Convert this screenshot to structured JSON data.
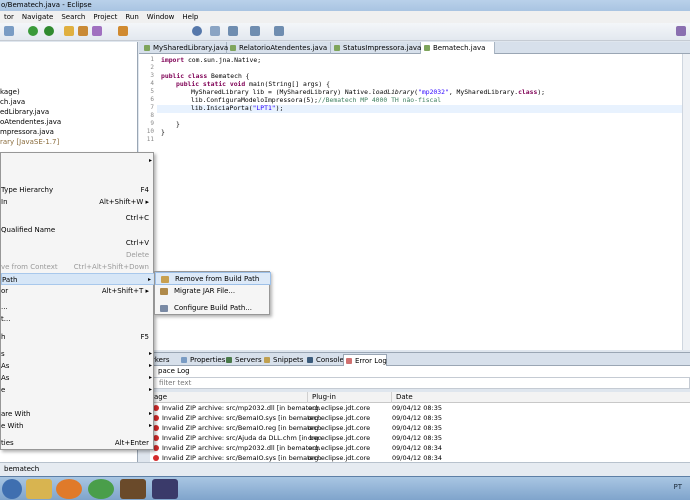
{
  "window": {
    "title": "o/Bematech.java - Eclipse"
  },
  "menu": [
    "tor",
    "Navigate",
    "Search",
    "Project",
    "Run",
    "Window",
    "Help"
  ],
  "tree": [
    "kage)",
    "ch.java",
    "edLibrary.java",
    "oAtendentes.java",
    "mpressora.java",
    "rary [JavaSE-1.7]"
  ],
  "tabs": [
    "MySharedLibrary.java",
    "RelatorioAtendentes.java",
    "StatusImpressora.java",
    "Bematech.java"
  ],
  "line_numbers": [
    "1",
    "2",
    "3",
    "4",
    "5",
    "6",
    "7",
    "8",
    "9",
    "10",
    "11"
  ],
  "code": {
    "l1_kw": "import",
    "l1_rest": " com.sun.jna.Native;",
    "l3_kw": "public class",
    "l3_rest": " Bematech {",
    "l4_kw": "public static void",
    "l4_rest": " main(String[] args) {",
    "l5_a": "MySharedLibrary lib = (MySharedLibrary) Native.",
    "l5_method": "loadLibrary",
    "l5_b": "(",
    "l5_str": "\"mp2032\"",
    "l5_c": ", MySharedLibrary.",
    "l5_kw": "class",
    "l5_d": ");",
    "l6_a": "lib.ConfiguraModeloImpressora(5);",
    "l6_cm": "//Bematech MP 4000 TH não-fiscal",
    "l7_a": "lib.IniciaPorta(",
    "l7_str": "\"LPT1\"",
    "l7_b": ");",
    "l9": "}",
    "l10": "}"
  },
  "context_menu": [
    {
      "label": "",
      "shortcut": "",
      "arrow": true,
      "disabled": false
    },
    {
      "label": "Type Hierarchy",
      "shortcut": "F4",
      "arrow": false,
      "disabled": false
    },
    {
      "label": "In",
      "shortcut": "Alt+Shift+W ▸",
      "arrow": false,
      "disabled": false
    },
    {
      "label": "",
      "shortcut": "Ctrl+C",
      "arrow": false,
      "disabled": false
    },
    {
      "label": "Qualified Name",
      "shortcut": "",
      "arrow": false,
      "disabled": false
    },
    {
      "label": "",
      "shortcut": "Ctrl+V",
      "arrow": false,
      "disabled": false
    },
    {
      "label": "",
      "shortcut": "Delete",
      "arrow": false,
      "disabled": true
    },
    {
      "label": "ve from Context",
      "shortcut": "Ctrl+Alt+Shift+Down",
      "arrow": false,
      "disabled": true
    },
    {
      "label": "Path",
      "shortcut": "",
      "arrow": true,
      "disabled": false
    },
    {
      "label": "or",
      "shortcut": "Alt+Shift+T ▸",
      "arrow": false,
      "disabled": false
    },
    {
      "label": "...",
      "shortcut": "",
      "arrow": false,
      "disabled": false
    },
    {
      "label": "t...",
      "shortcut": "",
      "arrow": false,
      "disabled": false
    },
    {
      "label": "h",
      "shortcut": "F5",
      "arrow": false,
      "disabled": false
    },
    {
      "label": "s",
      "shortcut": "",
      "arrow": true,
      "disabled": false
    },
    {
      "label": "As",
      "shortcut": "",
      "arrow": true,
      "disabled": false
    },
    {
      "label": "As",
      "shortcut": "",
      "arrow": true,
      "disabled": false
    },
    {
      "label": "e",
      "shortcut": "",
      "arrow": true,
      "disabled": false
    },
    {
      "label": "are With",
      "shortcut": "",
      "arrow": true,
      "disabled": false
    },
    {
      "label": "e With",
      "shortcut": "",
      "arrow": true,
      "disabled": false
    },
    {
      "label": "ties",
      "shortcut": "Alt+Enter",
      "arrow": false,
      "disabled": false
    }
  ],
  "submenu": [
    "Remove from Build Path",
    "Migrate JAR File...",
    "Configure Build Path..."
  ],
  "bottom_tabs": [
    "rkers",
    "Properties",
    "Servers",
    "Snippets",
    "Console",
    "Error Log"
  ],
  "log": {
    "title": "pace Log",
    "filter_placeholder": "filter text",
    "headers": [
      "age",
      "Plug-in",
      "Date"
    ],
    "rows": [
      [
        "Invalid ZIP archive: src/mp2032.dll [in bematech",
        "org.eclipse.jdt.core",
        "09/04/12 08:35"
      ],
      [
        "Invalid ZIP archive: src/BemaIO.sys [in bematech",
        "org.eclipse.jdt.core",
        "09/04/12 08:35"
      ],
      [
        "Invalid ZIP archive: src/BemaIO.reg [in bematech",
        "org.eclipse.jdt.core",
        "09/04/12 08:35"
      ],
      [
        "Invalid ZIP archive: src/Ajuda da DLL.chm [in ben",
        "org.eclipse.jdt.core",
        "09/04/12 08:35"
      ],
      [
        "Invalid ZIP archive: src/mp2032.dll [in bematech",
        "org.eclipse.jdt.core",
        "09/04/12 08:34"
      ],
      [
        "Invalid ZIP archive: src/BemaIO.sys [in bematech",
        "org.eclipse.jdt.core",
        "09/04/12 08:34"
      ]
    ]
  },
  "status": "bematech",
  "tray": "PT"
}
